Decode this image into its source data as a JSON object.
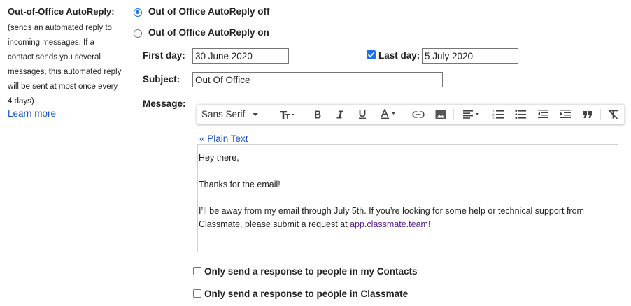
{
  "autoreply": {
    "title": "Out-of-Office AutoReply:",
    "description_lines": [
      "(sends an automated reply to",
      "incoming messages. If a",
      "contact sends you several",
      "messages, this automated reply",
      "will be sent at most once every",
      "4 days)"
    ],
    "learn_more": "Learn more",
    "option_off": "Out of Office AutoReply off",
    "option_on": "Out of Office AutoReply on",
    "selected_option": "off"
  },
  "dates": {
    "first_day_label": "First day:",
    "first_day_value": "30 June 2020",
    "last_day_label": "Last day:",
    "last_day_value": "5 July 2020",
    "last_day_enabled": true
  },
  "subject": {
    "label": "Subject:",
    "value": "Out Of Office"
  },
  "message": {
    "label": "Message:",
    "font_name": "Sans Serif",
    "toolbar_icons": [
      "font-size-icon",
      "bold-icon",
      "italic-icon",
      "underline-icon",
      "text-color-icon",
      "link-icon",
      "image-icon",
      "align-icon",
      "numbered-list-icon",
      "bulleted-list-icon",
      "indent-less-icon",
      "indent-more-icon",
      "quote-icon",
      "remove-formatting-icon"
    ],
    "plain_text_link": "« Plain Text",
    "body_greeting": "Hey there,",
    "body_thanks": "Thanks for the email!",
    "body_line3_text": "I’ll be away from my email through July 5th. If you’re looking for some help or technical support from Classmate, please submit a request at ",
    "body_link_text": "app.classmate.team",
    "body_line3_end": "!"
  },
  "options": {
    "contacts_only": "Only send a response to people in my Contacts",
    "contacts_only_checked": false,
    "classmate_only": "Only send a response to people in Classmate",
    "classmate_only_checked": false
  },
  "colors": {
    "accent": "#1a73e8",
    "link": "#1a57c4",
    "visited_link": "#551a8b"
  }
}
